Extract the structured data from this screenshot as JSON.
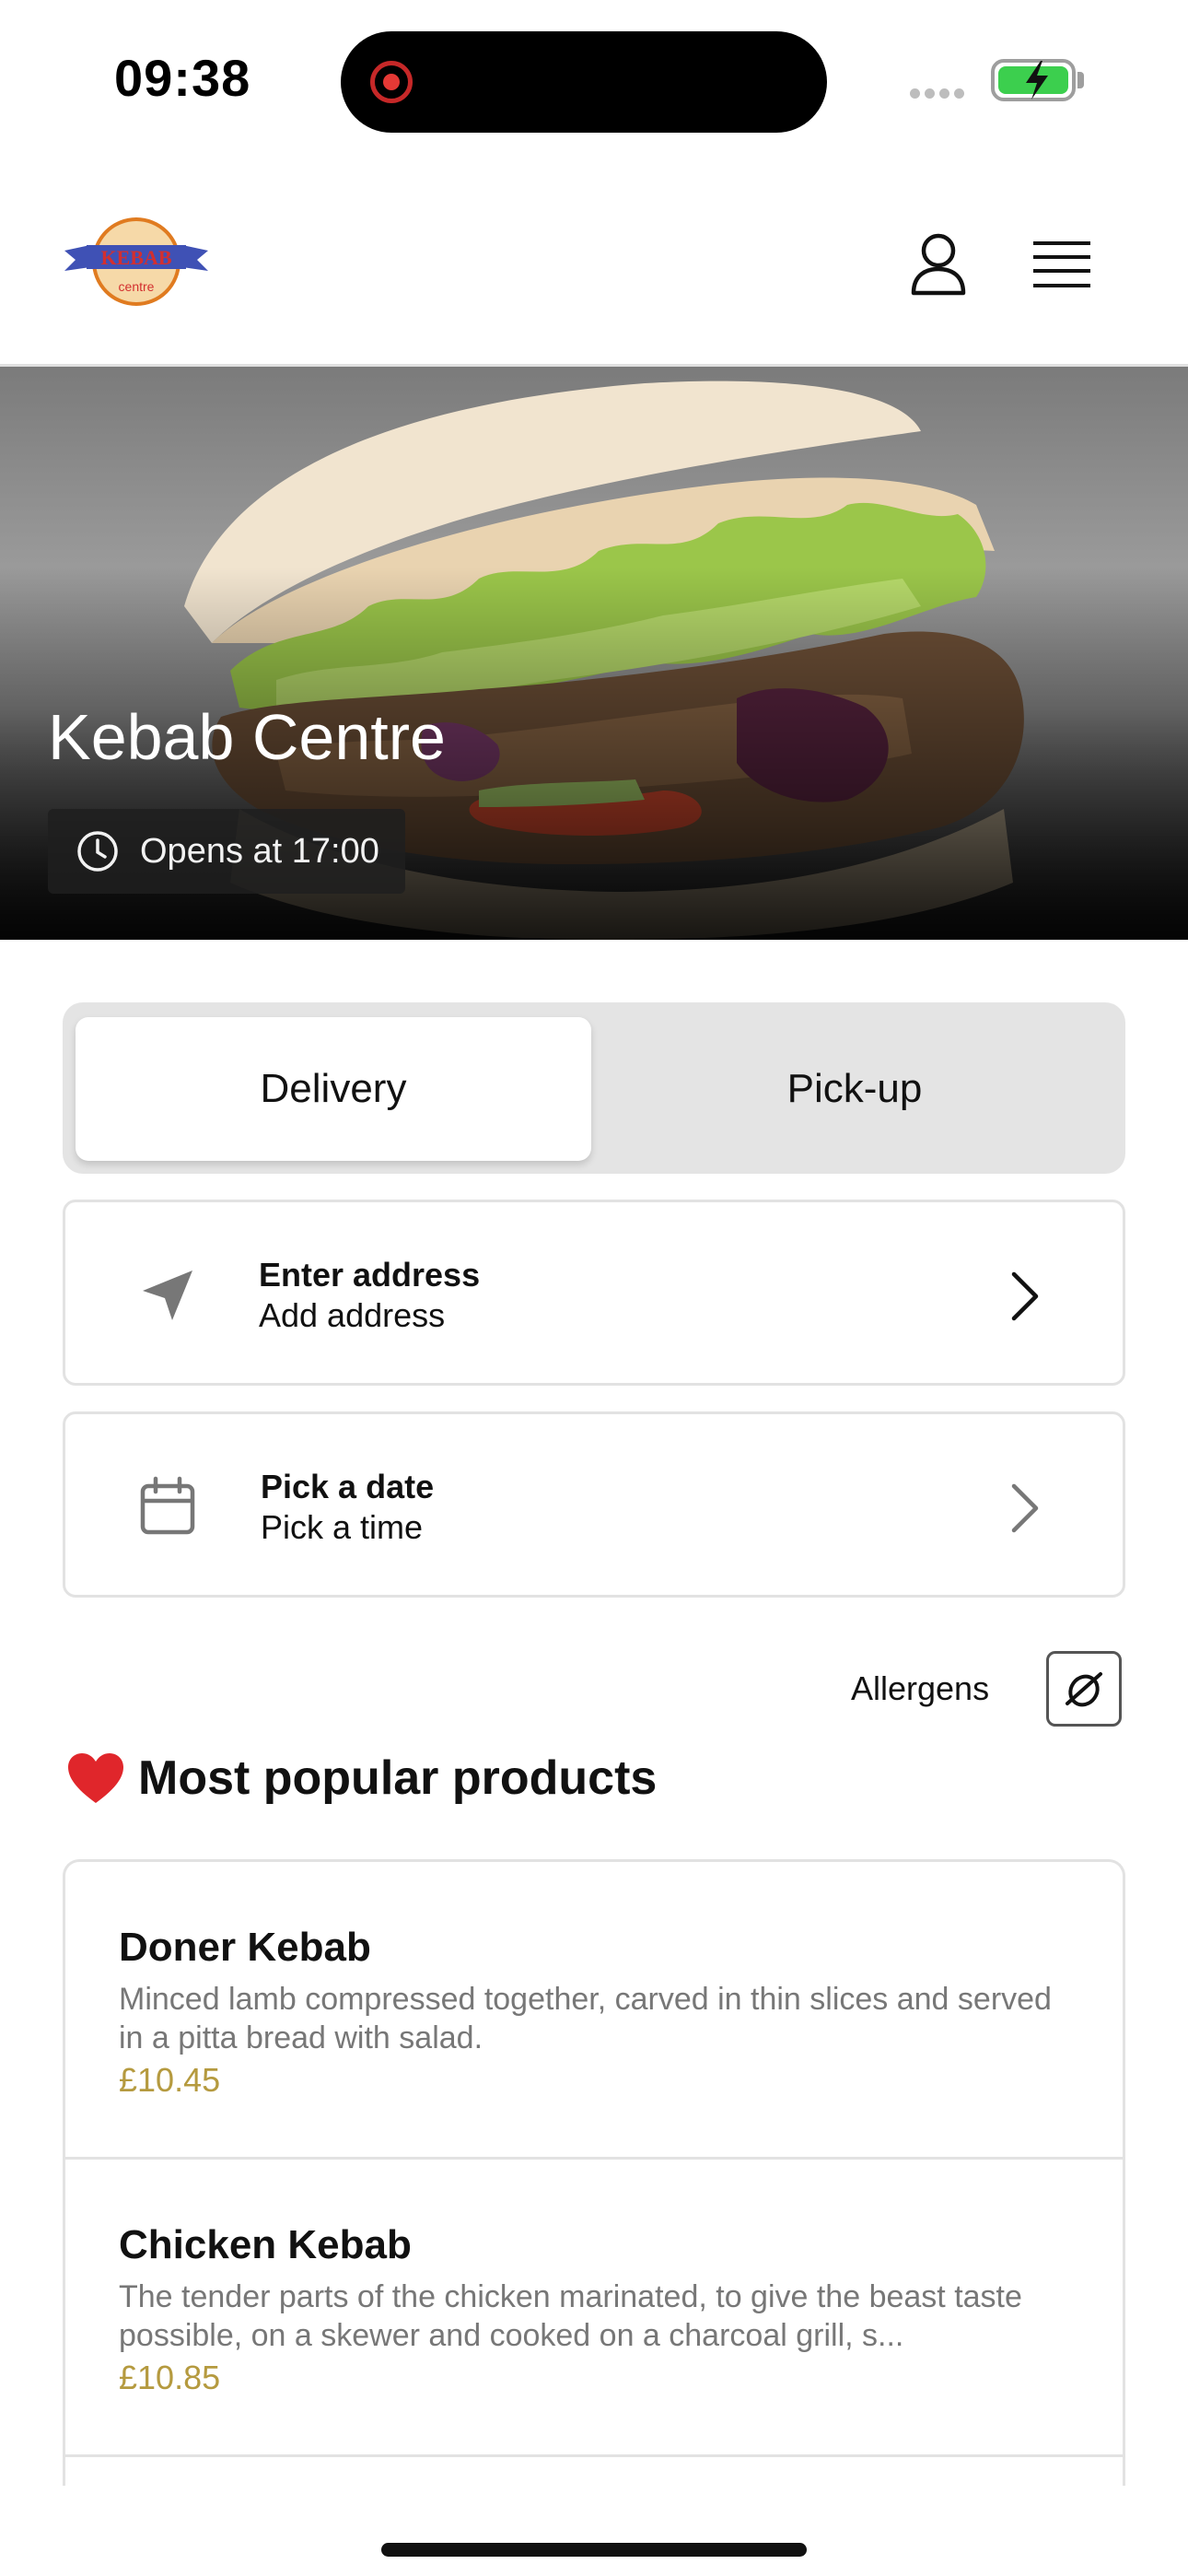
{
  "status_bar": {
    "time": "09:38"
  },
  "header": {
    "logo_text": "KEBAB",
    "logo_subtext": "centre"
  },
  "hero": {
    "title": "Kebab Centre",
    "hours": "Opens at 17:00"
  },
  "order_mode": {
    "options": [
      "Delivery",
      "Pick-up"
    ],
    "selected": "Delivery"
  },
  "address": {
    "title": "Enter address",
    "subtitle": "Add address"
  },
  "schedule": {
    "title": "Pick a date",
    "subtitle": "Pick a time"
  },
  "allergens": {
    "label": "Allergens"
  },
  "popular": {
    "heading": "Most popular products",
    "products": [
      {
        "name": "Doner Kebab",
        "description": "Minced lamb compressed together, carved in thin slices and served in a pitta bread with salad.",
        "price": "£10.45"
      },
      {
        "name": "Chicken Kebab",
        "description": "The tender parts of the chicken marinated, to give the beast taste possible, on a skewer and cooked on a charcoal grill, s...",
        "price": "£10.85"
      }
    ]
  },
  "colors": {
    "accent_price": "#b59a3f",
    "battery": "#3ccf4e",
    "logo_blue": "#3f51b5",
    "logo_red": "#d32f2f"
  }
}
